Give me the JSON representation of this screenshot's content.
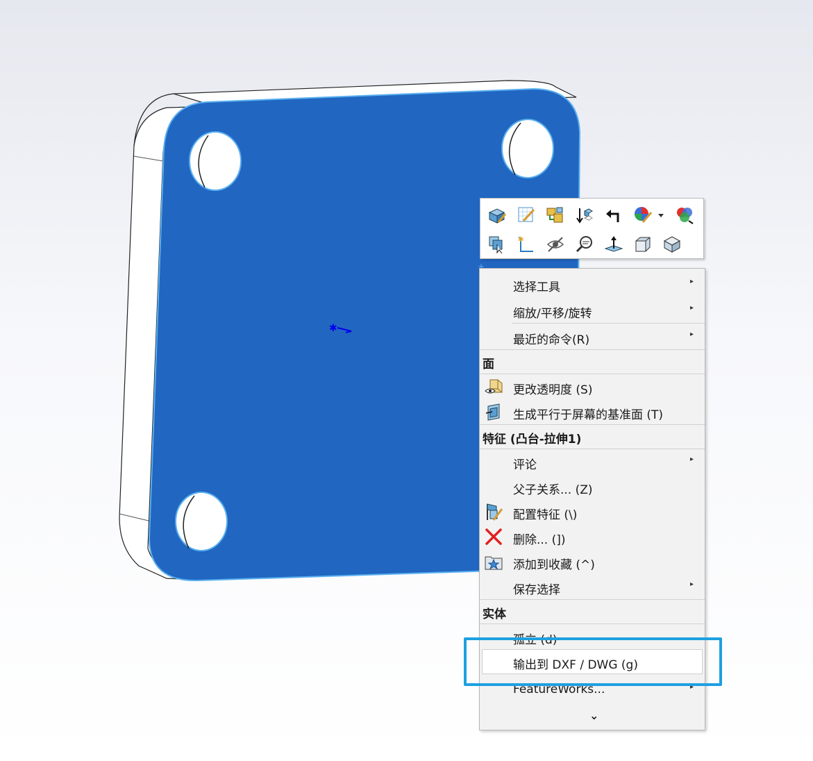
{
  "toolbar": {
    "row1_icons": [
      "edit-feature-icon",
      "edit-sketch-icon",
      "cross-section-icon",
      "rollback-icon",
      "undo-arrow-icon",
      "appearance-icon",
      "appearance-dropdown-icon",
      "display-states-icon"
    ],
    "row2_icons": [
      "select-other-icon",
      "sketch-icon",
      "hide-icon",
      "zoom-to-selection-icon",
      "normal-to-icon",
      "front-view-icon",
      "isometric-view-icon"
    ]
  },
  "menu": {
    "items_top": [
      {
        "label": "选择工具",
        "submenu": true
      },
      {
        "label": "缩放/平移/旋转",
        "submenu": true
      },
      {
        "label": "最近的命令(R)",
        "submenu": true
      }
    ],
    "section_face": "面",
    "face_items": [
      {
        "label": "更改透明度 (S)",
        "icon": "transparency-icon"
      },
      {
        "label": "生成平行于屏幕的基准面 (T)",
        "icon": "plane-parallel-screen-icon"
      }
    ],
    "section_feature": "特征 (凸台-拉伸1)",
    "feature_items": [
      {
        "label": "评论",
        "submenu": true
      },
      {
        "label": "父子关系... (Z)"
      },
      {
        "label": "配置特征 (\\)",
        "icon": "configure-feature-icon"
      },
      {
        "label": "删除... (])",
        "icon": "delete-icon"
      },
      {
        "label": "添加到收藏 (^)",
        "icon": "favorites-icon"
      },
      {
        "label": "保存选择",
        "submenu": true
      }
    ],
    "section_body": "实体",
    "body_items": [
      {
        "label": "孤立 (d)"
      },
      {
        "label": "输出到 DXF / DWG (g)"
      },
      {
        "label": "FeatureWorks...",
        "submenu": true
      }
    ],
    "expand_glyph": "⌄",
    "submenu_arrow": "▸"
  },
  "colors": {
    "face_blue": "#2166c1",
    "highlight": "#1ea0e0",
    "menu_bg": "#f2f2f2"
  }
}
